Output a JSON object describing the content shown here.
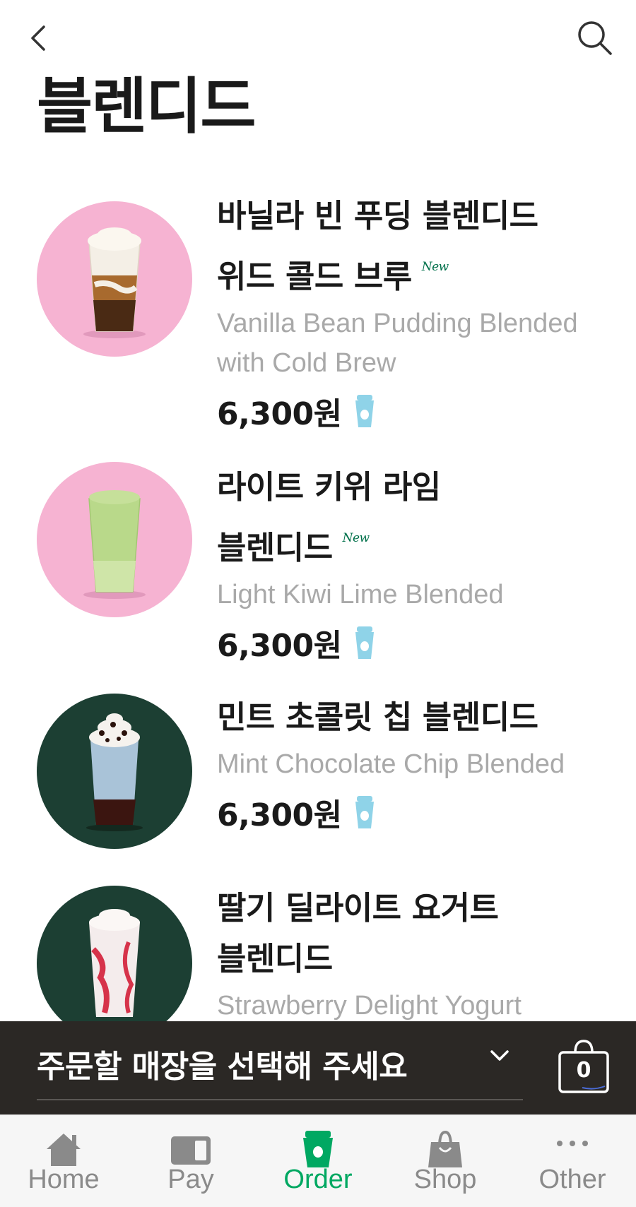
{
  "header": {
    "title": "블렌디드",
    "back_icon": "chevron-left-icon",
    "search_icon": "search-icon"
  },
  "menu_items": [
    {
      "name_ko_line1": "바닐라 빈 푸딩 블렌디드",
      "name_ko_line2": "위드 콜드 브루",
      "badge": "New",
      "name_en_line1": "Vanilla Bean Pudding Blended",
      "name_en_line2": "with Cold Brew",
      "price": "6,300원",
      "thumb_bg": "#f6b3d2"
    },
    {
      "name_ko_line1": "라이트 키위 라임",
      "name_ko_line2": "블렌디드",
      "badge": "New",
      "name_en_line1": "Light Kiwi Lime Blended",
      "price": "6,300원",
      "thumb_bg": "#f6b3d2"
    },
    {
      "name_ko_line1": "민트 초콜릿 칩 블렌디드",
      "name_en_line1": "Mint Chocolate Chip Blended",
      "price": "6,300원",
      "thumb_bg": "#1c3f33"
    },
    {
      "name_ko_line1": "딸기 딜라이트 요거트",
      "name_ko_line2": "블렌디드",
      "name_en_line1": "Strawberry Delight Yogurt",
      "thumb_bg": "#1c3f33"
    }
  ],
  "order_bar": {
    "store_placeholder": "주문할 매장을 선택해 주세요",
    "cart_count": "0",
    "background": "#2b2825"
  },
  "tabs": [
    {
      "label": "Home",
      "icon": "home-icon",
      "active": false
    },
    {
      "label": "Pay",
      "icon": "card-icon",
      "active": false
    },
    {
      "label": "Order",
      "icon": "cup-icon",
      "active": true
    },
    {
      "label": "Shop",
      "icon": "shopping-bag-icon",
      "active": false
    },
    {
      "label": "Other",
      "icon": "more-icon",
      "active": false
    }
  ],
  "colors": {
    "accent_green": "#00a862",
    "new_badge_green": "#00704a",
    "english_name_gray": "#a9a9a9",
    "tab_inactive": "#8a8a8a"
  }
}
